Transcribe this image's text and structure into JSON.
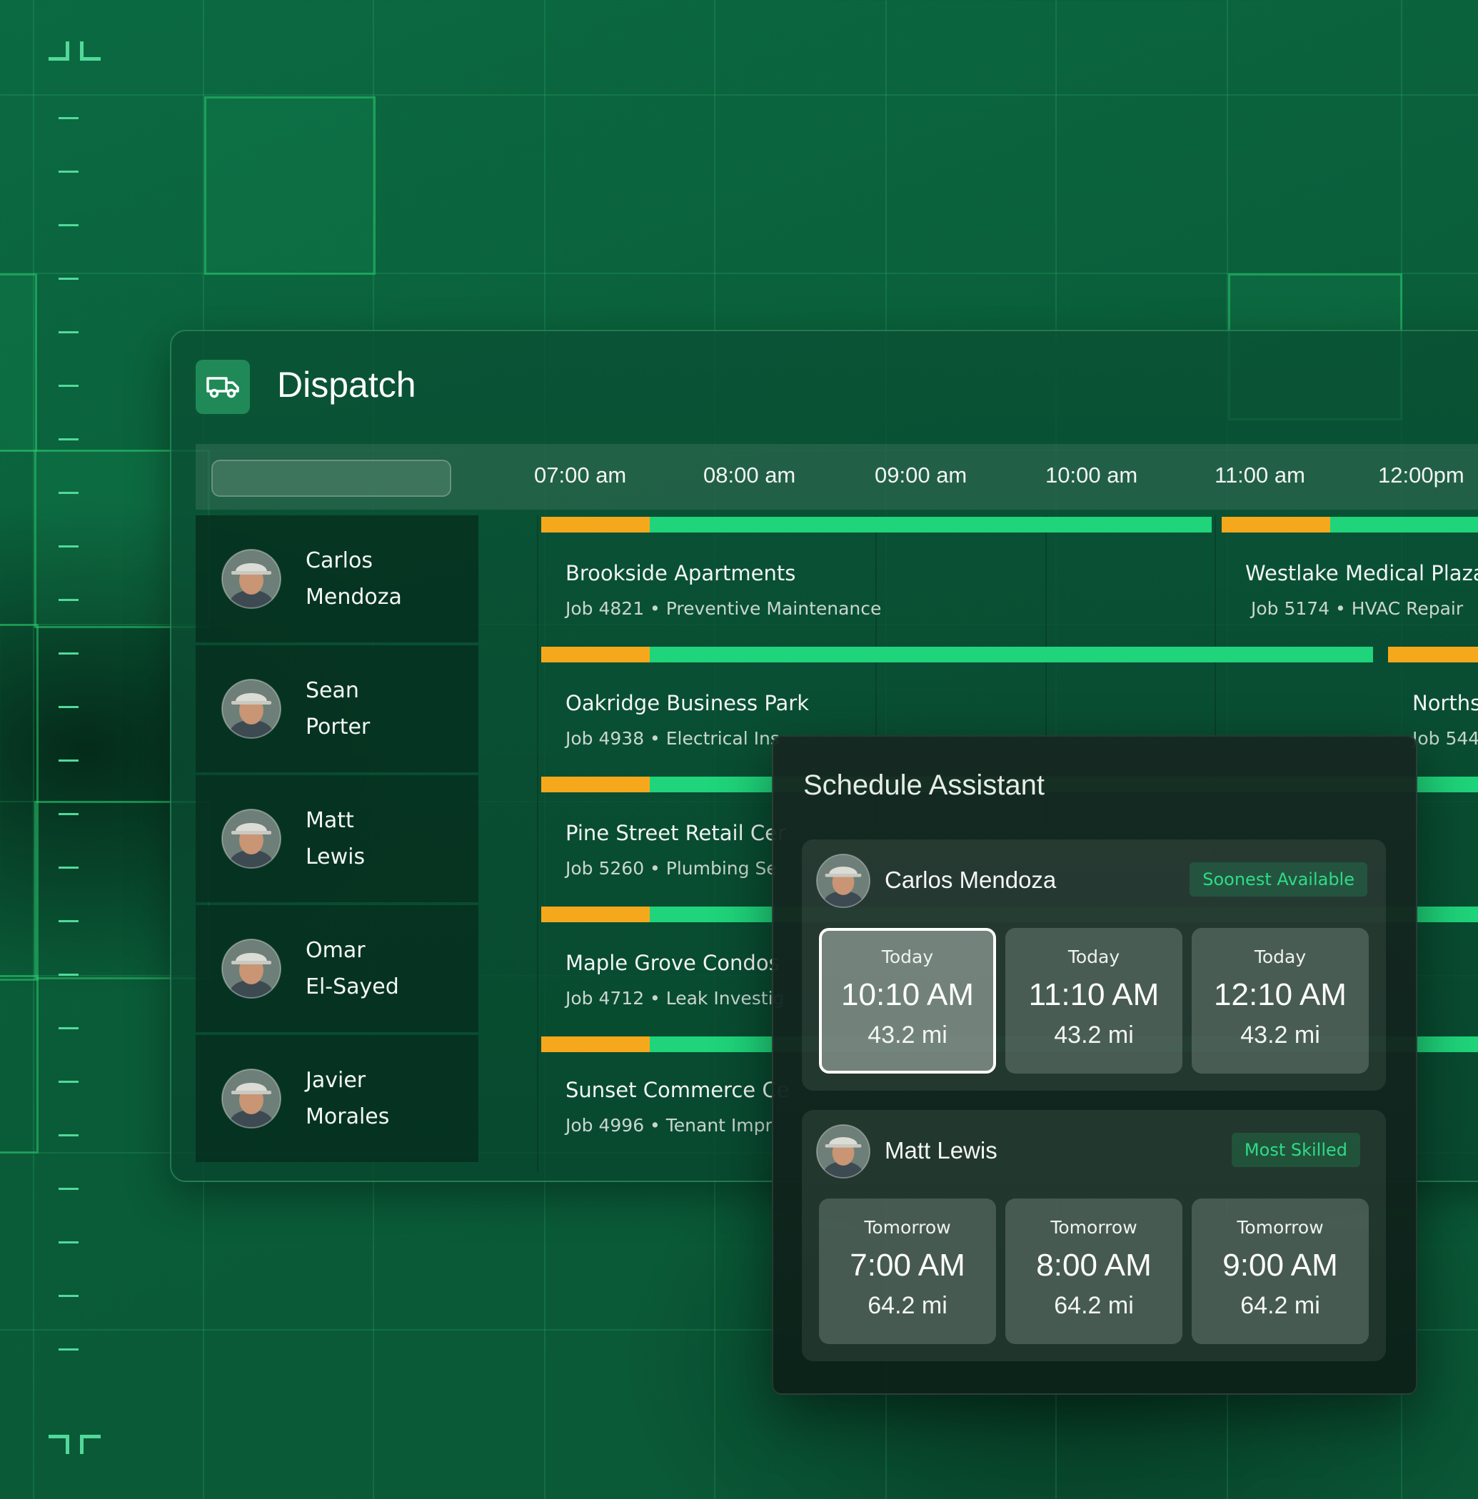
{
  "header": {
    "title": "Dispatch",
    "icon": "truck-icon"
  },
  "timeline": {
    "search_placeholder": "",
    "times": [
      "07:00 am",
      "08:00 am",
      "09:00 am",
      "10:00 am",
      "11:00 am",
      "12:00pm"
    ]
  },
  "technicians": [
    {
      "first": "Carlos",
      "last": "Mendoza"
    },
    {
      "first": "Sean",
      "last": "Porter"
    },
    {
      "first": "Matt",
      "last": "Lewis"
    },
    {
      "first": "Omar",
      "last": "El-Sayed"
    },
    {
      "first": "Javier",
      "last": "Morales"
    }
  ],
  "jobs": [
    {
      "title": "Brookside Apartments",
      "sub": "Job 4821 • Preventive Maintenance"
    },
    {
      "title": "Westlake Medical Plaza",
      "sub": "Job 5174 • HVAC Repair"
    },
    {
      "title": "Oakridge Business Park",
      "sub": "Job 4938 • Electrical Ins"
    },
    {
      "title": "Norths",
      "sub": "Job 544"
    },
    {
      "title": "Pine Street Retail Cer",
      "sub": "Job 5260 • Plumbing Se"
    },
    {
      "title": "Maple Grove Condos",
      "sub": "Job 4712 • Leak Investig"
    },
    {
      "title": "Sunset Commerce Ce",
      "sub": "Job 4996 • Tenant Impr"
    }
  ],
  "assistant": {
    "title": "Schedule Assistant",
    "cards": [
      {
        "name": "Carlos Mendoza",
        "badge": "Soonest Available",
        "slots": [
          {
            "day": "Today",
            "time": "10:10 AM",
            "dist": "43.2 mi",
            "selected": true
          },
          {
            "day": "Today",
            "time": "11:10 AM",
            "dist": "43.2 mi",
            "selected": false
          },
          {
            "day": "Today",
            "time": "12:10 AM",
            "dist": "43.2 mi",
            "selected": false
          }
        ]
      },
      {
        "name": "Matt Lewis",
        "badge": "Most Skilled",
        "slots": [
          {
            "day": "Tomorrow",
            "time": "7:00 AM",
            "dist": "64.2 mi",
            "selected": false
          },
          {
            "day": "Tomorrow",
            "time": "8:00 AM",
            "dist": "64.2 mi",
            "selected": false
          },
          {
            "day": "Tomorrow",
            "time": "9:00 AM",
            "dist": "64.2 mi",
            "selected": false
          }
        ]
      }
    ]
  },
  "colors": {
    "accent": "#1fd47a",
    "travel": "#f6a81c",
    "background": "#0a5d39"
  }
}
